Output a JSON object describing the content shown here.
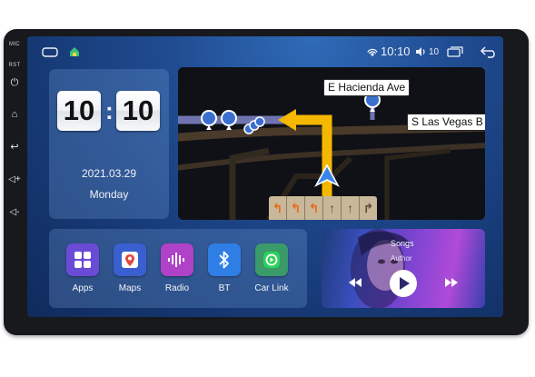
{
  "device": {
    "side_labels": {
      "mic": "MIC",
      "rst": "RST"
    },
    "side_buttons": [
      "power-icon",
      "home-icon",
      "back-icon",
      "volume-up-icon",
      "volume-down-icon"
    ]
  },
  "status_bar": {
    "time": "10:10",
    "volume_level": "10",
    "icons": [
      "hotspot-icon",
      "volume-icon",
      "recent-apps-icon",
      "back-icon"
    ]
  },
  "clock": {
    "hours": "10",
    "minutes": "10",
    "separator": ":",
    "date": "2021.03.29",
    "weekday": "Monday"
  },
  "navigation": {
    "street_1": "E Hacienda Ave",
    "street_2": "S Las Vegas B",
    "lane_arrows": [
      "↰",
      "↰",
      "↰",
      "↑",
      "↑",
      "↱"
    ],
    "colors": {
      "route": "#f5b800",
      "road": "#5a4634",
      "side_road": "#7a7fb8",
      "lane_active": "#e86a1a"
    }
  },
  "apps": [
    {
      "label": "Apps",
      "icon": "apps-grid-icon",
      "color": "#6a4bd6"
    },
    {
      "label": "Maps",
      "icon": "maps-pin-icon",
      "color": "#3a5fd0"
    },
    {
      "label": "Radio",
      "icon": "radio-wave-icon",
      "color": "#b042c8"
    },
    {
      "label": "BT",
      "icon": "bluetooth-icon",
      "color": "#2f7ee6"
    },
    {
      "label": "Car Link",
      "icon": "car-link-icon",
      "color": "#3a9a6a"
    }
  ],
  "music": {
    "title": "Songs",
    "artist": "Author",
    "controls": [
      "rewind-icon",
      "play-icon",
      "fast-forward-icon"
    ]
  }
}
